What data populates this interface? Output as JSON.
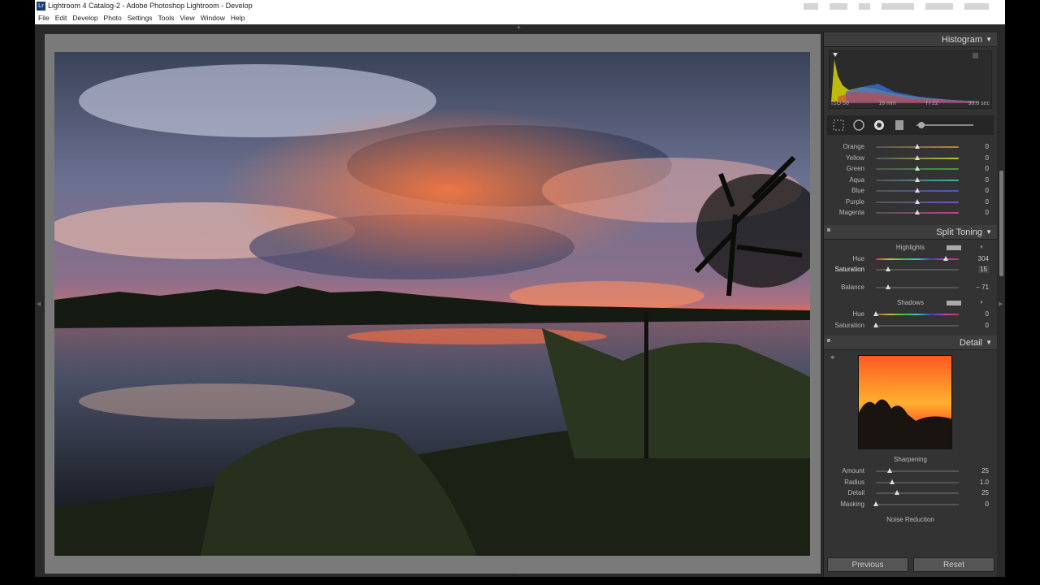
{
  "window": {
    "title": "Lightroom 4 Catalog-2 - Adobe Photoshop Lightroom - Develop",
    "app_icon": "Lr"
  },
  "menu": [
    "File",
    "Edit",
    "Develop",
    "Photo",
    "Settings",
    "Tools",
    "View",
    "Window",
    "Help"
  ],
  "histogram": {
    "header": "Histogram",
    "info": [
      "ISO 50",
      "16 mm",
      "f / 22",
      "30.0 sec"
    ]
  },
  "hsl": {
    "rows": [
      {
        "label": "Orange",
        "value": "0"
      },
      {
        "label": "Yellow",
        "value": "0"
      },
      {
        "label": "Green",
        "value": "0"
      },
      {
        "label": "Aqua",
        "value": "0"
      },
      {
        "label": "Blue",
        "value": "0"
      },
      {
        "label": "Purple",
        "value": "0"
      },
      {
        "label": "Magenta",
        "value": "0"
      }
    ]
  },
  "split_toning": {
    "header": "Split Toning",
    "highlights_label": "Highlights",
    "highlights_hue": {
      "label": "Hue",
      "value": "304"
    },
    "highlights_saturation": {
      "label": "Saturation",
      "value": "15"
    },
    "balance": {
      "label": "Balance",
      "value": "− 71"
    },
    "shadows_label": "Shadows",
    "shadows_hue": {
      "label": "Hue",
      "value": "0"
    },
    "shadows_saturation": {
      "label": "Saturation",
      "value": "0"
    }
  },
  "detail": {
    "header": "Detail",
    "sharpening_label": "Sharpening",
    "amount": {
      "label": "Amount",
      "value": "25"
    },
    "radius": {
      "label": "Radius",
      "value": "1.0"
    },
    "detail": {
      "label": "Detail",
      "value": "25"
    },
    "masking": {
      "label": "Masking",
      "value": "0"
    },
    "noise_label": "Noise Reduction"
  },
  "buttons": {
    "previous": "Previous",
    "reset": "Reset"
  },
  "colors": {
    "panel_bg": "#333333",
    "stage_bg": "#7a7a7a"
  }
}
